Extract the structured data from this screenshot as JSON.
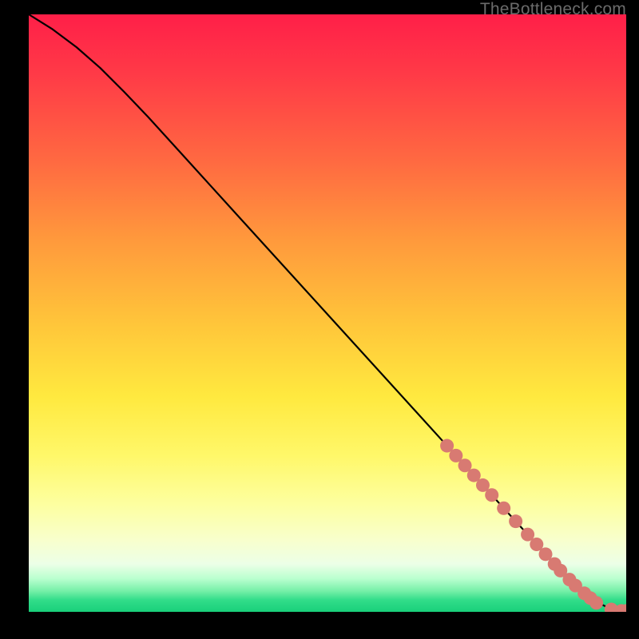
{
  "watermark": "TheBottleneck.com",
  "chart_data": {
    "type": "line",
    "title": "",
    "xlabel": "",
    "ylabel": "",
    "xlim": [
      0,
      100
    ],
    "ylim": [
      0,
      100
    ],
    "grid": false,
    "legend": false,
    "series": [
      {
        "name": "curve",
        "style": "line",
        "color": "#000000",
        "x": [
          0,
          4,
          8,
          12,
          16,
          20,
          25,
          30,
          35,
          40,
          45,
          50,
          55,
          60,
          65,
          70,
          73,
          76,
          79,
          82,
          85,
          88,
          90,
          92,
          94,
          95.5,
          97,
          98,
          99,
          100
        ],
        "y": [
          100,
          97.5,
          94.5,
          91,
          87,
          82.8,
          77.3,
          71.8,
          66.3,
          60.8,
          55.3,
          49.8,
          44.3,
          38.8,
          33.3,
          27.8,
          24.5,
          21.2,
          17.9,
          14.6,
          11.3,
          8.0,
          5.8,
          3.9,
          2.3,
          1.4,
          0.7,
          0.3,
          0.15,
          0.15
        ]
      },
      {
        "name": "points",
        "style": "scatter",
        "color": "#d87a72",
        "x": [
          70,
          71.5,
          73,
          74.5,
          76,
          77.5,
          79.5,
          81.5,
          83.5,
          85,
          86.5,
          88,
          89,
          90.5,
          91.5,
          93,
          94,
          95,
          97.5,
          99.2,
          100
        ],
        "y": [
          27.8,
          26.15,
          24.5,
          22.85,
          21.2,
          19.55,
          17.35,
          15.15,
          12.95,
          11.3,
          9.65,
          8.0,
          6.9,
          5.4,
          4.4,
          3.1,
          2.3,
          1.5,
          0.4,
          0.15,
          0.15
        ]
      }
    ]
  }
}
